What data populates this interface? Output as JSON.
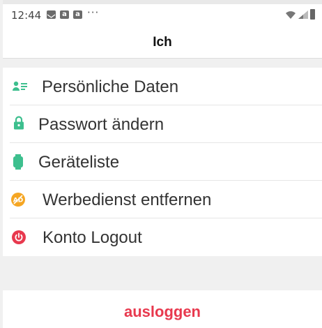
{
  "status_bar": {
    "time": "12:44",
    "icons": [
      "mail-icon",
      "a-badge-icon",
      "a-badge-icon",
      "more-dots-icon",
      "wifi-icon",
      "signal-icon",
      "battery-icon"
    ],
    "dots": "···"
  },
  "header": {
    "title": "Ich"
  },
  "menu": {
    "items": [
      {
        "label": "Persönliche Daten",
        "icon": "contact-card-icon",
        "color": "#3dbf8e"
      },
      {
        "label": "Passwort ändern",
        "icon": "lock-icon",
        "color": "#3dbf8e"
      },
      {
        "label": "Geräteliste",
        "icon": "watch-icon",
        "color": "#3dbf8e"
      },
      {
        "label": "Werbedienst entfernen",
        "icon": "no-ads-icon",
        "color": "#f5a623"
      },
      {
        "label": "Konto Logout",
        "icon": "power-icon",
        "color": "#e8394e"
      }
    ]
  },
  "footer": {
    "logout_label": "ausloggen",
    "accent": "#e8394e"
  }
}
